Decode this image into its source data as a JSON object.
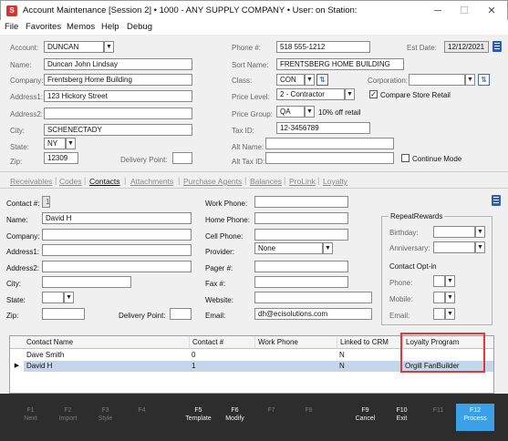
{
  "window": {
    "title": "Account Maintenance [Session 2]  •  1000 - ANY SUPPLY COMPANY  •  User:             on Station:",
    "app_icon": "S",
    "minimize": "─",
    "maximize": "☐",
    "close": "✕"
  },
  "menu": {
    "file": "File",
    "favorites": "Favorites",
    "memos": "Memos",
    "help": "Help",
    "debug": "Debug"
  },
  "account": {
    "account_label": "Account:",
    "account": "DUNCAN",
    "name_label": "Name:",
    "name": "Duncan John Lindsay",
    "company_label": "Company:",
    "company": "Frentsberg Home Building",
    "address1_label": "Address1:",
    "address1": "123 Hickory Street",
    "address2_label": "Address2:",
    "address2": "",
    "city_label": "City:",
    "city": "SCHENECTADY",
    "state_label": "State:",
    "state": "NY",
    "zip_label": "Zip:",
    "zip": "12309",
    "delivery_label": "Delivery Point:",
    "delivery": "",
    "phone_label": "Phone #:",
    "phone": "518 555-1212",
    "estdate_label": "Est Date:",
    "estdate": "12/12/2021",
    "sortname_label": "Sort Name:",
    "sortname": "FRENTSBERG HOME BUILDING",
    "class_label": "Class:",
    "class": "CON",
    "corporation_label": "Corporation:",
    "corporation": "",
    "pricelevel_label": "Price Level:",
    "pricelevel": "2 - Contractor",
    "compare_label": "Compare Store Retail",
    "compare_checked": "✓",
    "pricegroup_label": "Price Group:",
    "pricegroup": "QA",
    "pricegroup_desc": "10% off retail",
    "taxid_label": "Tax ID:",
    "taxid": "12-3456789",
    "altname_label": "Alt Name:",
    "altname": "",
    "alttaxid_label": "Alt Tax ID:",
    "alttaxid": "",
    "continue_label": "Continue Mode",
    "continue_checked": ""
  },
  "tabs": [
    "Receivables",
    "Codes",
    "Contacts",
    "Attachments",
    "Purchase Agents",
    "Balances",
    "ProLink",
    "Loyalty"
  ],
  "contact": {
    "contactnum_label": "Contact #:",
    "contactnum": "1",
    "name_label": "Name:",
    "name": "David H",
    "company_label": "Company:",
    "company": "",
    "address1_label": "Address1:",
    "address1": "",
    "address2_label": "Address2:",
    "address2": "",
    "city_label": "City:",
    "city": "",
    "state_label": "State:",
    "state": "",
    "zip_label": "Zip:",
    "zip": "",
    "delivery_label": "Delivery Point:",
    "delivery": "",
    "workphone_label": "Work Phone:",
    "workphone": "",
    "homephone_label": "Home Phone:",
    "homephone": "",
    "cellphone_label": "Cell Phone:",
    "cellphone": "",
    "provider_label": "Provider:",
    "provider": "None",
    "pager_label": "Pager #:",
    "pager": "",
    "fax_label": "Fax #:",
    "fax": "",
    "website_label": "Website:",
    "website": "",
    "email_label": "Email:",
    "email": "dh@ecisolutions.com"
  },
  "rewards": {
    "title": "RepeatRewards",
    "birthday_label": "Birthday:",
    "birthday": "",
    "anniversary_label": "Anniversary:",
    "anniversary": "",
    "optin_title": "Contact Opt-in",
    "phone_label": "Phone:",
    "phone": "",
    "mobile_label": "Mobile:",
    "mobile": "",
    "email_label": "Email:",
    "email": ""
  },
  "grid": {
    "headers": [
      "Contact Name",
      "Contact #",
      "Work Phone",
      "Linked to CRM",
      "Loyalty Program"
    ],
    "rows": [
      {
        "name": "Dave Smith",
        "num": "0",
        "phone": "",
        "crm": "N",
        "loyalty": ""
      },
      {
        "name": "David H",
        "num": "1",
        "phone": "",
        "crm": "N",
        "loyalty": "Orgill FanBuilder"
      }
    ],
    "row_marker": "▶"
  },
  "fkeys": [
    {
      "key": "F1",
      "label": "Next"
    },
    {
      "key": "F2",
      "label": "Import"
    },
    {
      "key": "F3",
      "label": "Style"
    },
    {
      "key": "F4",
      "label": ""
    },
    {
      "key": "F5",
      "label": "Template"
    },
    {
      "key": "F6",
      "label": "Modify"
    },
    {
      "key": "F7",
      "label": ""
    },
    {
      "key": "F8",
      "label": ""
    },
    {
      "key": "F9",
      "label": "Cancel"
    },
    {
      "key": "F10",
      "label": "Exit"
    },
    {
      "key": "F11",
      "label": ""
    },
    {
      "key": "F12",
      "label": "Process"
    }
  ],
  "colors": {
    "accent": "#3aa0e8",
    "highlight": "#e03838",
    "selection": "#c5d6ea",
    "fbar": "#2d2d2d"
  }
}
